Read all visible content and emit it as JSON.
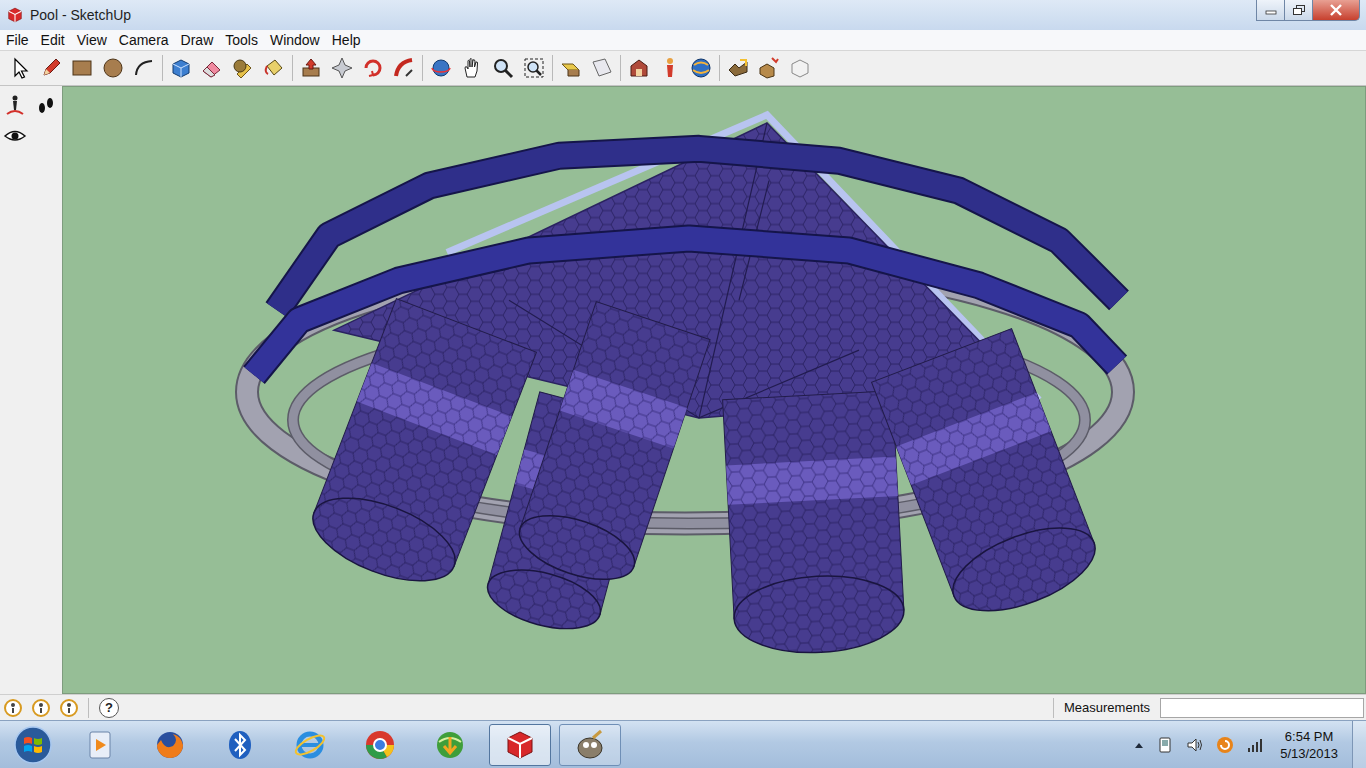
{
  "window": {
    "title": "Pool - SketchUp"
  },
  "menu": [
    "File",
    "Edit",
    "View",
    "Camera",
    "Draw",
    "Tools",
    "Window",
    "Help"
  ],
  "status_bar": {
    "help": "?",
    "measurements_label": "Measurements",
    "measurements_value": ""
  },
  "taskbar": {
    "buttons": [
      {
        "running": false,
        "active": false
      },
      {
        "running": false,
        "active": false
      },
      {
        "running": false,
        "active": false
      },
      {
        "running": false,
        "active": false
      },
      {
        "running": false,
        "active": false
      },
      {
        "running": false,
        "active": false
      },
      {
        "running": true,
        "active": true
      },
      {
        "running": true,
        "active": false
      }
    ],
    "clock": {
      "time": "6:54 PM",
      "date": "5/13/2013"
    }
  }
}
